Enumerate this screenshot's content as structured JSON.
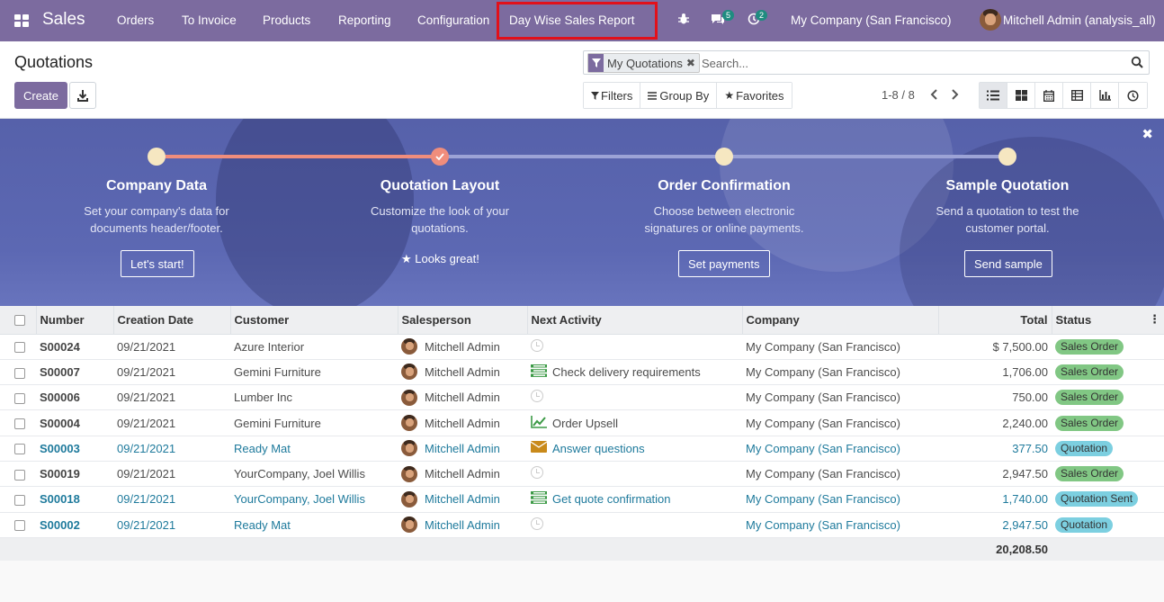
{
  "topbar": {
    "brand": "Sales",
    "menu": [
      "Orders",
      "To Invoice",
      "Products",
      "Reporting",
      "Configuration",
      "Day Wise Sales Report"
    ],
    "messages_count": "5",
    "activities_count": "2",
    "company": "My Company (San Francisco)",
    "user": "Mitchell Admin (analysis_all)"
  },
  "control_panel": {
    "title": "Quotations",
    "create_label": "Create",
    "search_facet": "My Quotations",
    "search_placeholder": "Search...",
    "filters_label": "Filters",
    "groupby_label": "Group By",
    "favorites_label": "Favorites",
    "pager": "1-8 / 8",
    "views": [
      "list-view-icon",
      "kanban-view-icon",
      "calendar-view-icon",
      "pivot-view-icon",
      "graph-view-icon",
      "activity-view-icon"
    ]
  },
  "onboarding": {
    "steps": [
      {
        "title": "Company Data",
        "desc": "Set your company's data for documents header/footer.",
        "button": "Let's start!"
      },
      {
        "title": "Quotation Layout",
        "desc": "Customize the look of your quotations.",
        "done_label": "Looks great!"
      },
      {
        "title": "Order Confirmation",
        "desc": "Choose between electronic signatures or online payments.",
        "button": "Set payments"
      },
      {
        "title": "Sample Quotation",
        "desc": "Send a quotation to test the customer portal.",
        "button": "Send sample"
      }
    ]
  },
  "table": {
    "columns": [
      "Number",
      "Creation Date",
      "Customer",
      "Salesperson",
      "Next Activity",
      "Company",
      "Total",
      "Status"
    ],
    "rows": [
      {
        "number": "S00024",
        "date": "09/21/2021",
        "customer": "Azure Interior",
        "salesperson": "Mitchell Admin",
        "activity": "",
        "activity_icon": "clock-icon",
        "company": "My Company (San Francisco)",
        "total": "$ 7,500.00",
        "status": "Sales Order",
        "style": "normal"
      },
      {
        "number": "S00007",
        "date": "09/21/2021",
        "customer": "Gemini Furniture",
        "salesperson": "Mitchell Admin",
        "activity": "Check delivery requirements",
        "activity_icon": "tasks-icon",
        "company": "My Company (San Francisco)",
        "total": "1,706.00",
        "status": "Sales Order",
        "style": "normal"
      },
      {
        "number": "S00006",
        "date": "09/21/2021",
        "customer": "Lumber Inc",
        "salesperson": "Mitchell Admin",
        "activity": "",
        "activity_icon": "clock-icon",
        "company": "My Company (San Francisco)",
        "total": "750.00",
        "status": "Sales Order",
        "style": "normal"
      },
      {
        "number": "S00004",
        "date": "09/21/2021",
        "customer": "Gemini Furniture",
        "salesperson": "Mitchell Admin",
        "activity": "Order Upsell",
        "activity_icon": "upsell-chart-icon",
        "company": "My Company (San Francisco)",
        "total": "2,240.00",
        "status": "Sales Order",
        "style": "normal"
      },
      {
        "number": "S00003",
        "date": "09/21/2021",
        "customer": "Ready Mat",
        "salesperson": "Mitchell Admin",
        "activity": "Answer questions",
        "activity_icon": "envelope-icon",
        "company": "My Company (San Francisco)",
        "total": "377.50",
        "status": "Quotation",
        "style": "blue"
      },
      {
        "number": "S00019",
        "date": "09/21/2021",
        "customer": "YourCompany, Joel Willis",
        "salesperson": "Mitchell Admin",
        "activity": "",
        "activity_icon": "clock-icon",
        "company": "My Company (San Francisco)",
        "total": "2,947.50",
        "status": "Sales Order",
        "style": "normal"
      },
      {
        "number": "S00018",
        "date": "09/21/2021",
        "customer": "YourCompany, Joel Willis",
        "salesperson": "Mitchell Admin",
        "activity": "Get quote confirmation",
        "activity_icon": "tasks-icon",
        "company": "My Company (San Francisco)",
        "total": "1,740.00",
        "status": "Quotation Sent",
        "style": "blue"
      },
      {
        "number": "S00002",
        "date": "09/21/2021",
        "customer": "Ready Mat",
        "salesperson": "Mitchell Admin",
        "activity": "",
        "activity_icon": "clock-icon",
        "company": "My Company (San Francisco)",
        "total": "2,947.50",
        "status": "Quotation",
        "style": "blue"
      }
    ],
    "grand_total": "20,208.50"
  },
  "colors": {
    "brand": "#7c6b9f",
    "highlight": "#e2101a",
    "sales_order": "#81c784",
    "quotation": "#7ccfe0",
    "link": "#1e7a9c"
  }
}
